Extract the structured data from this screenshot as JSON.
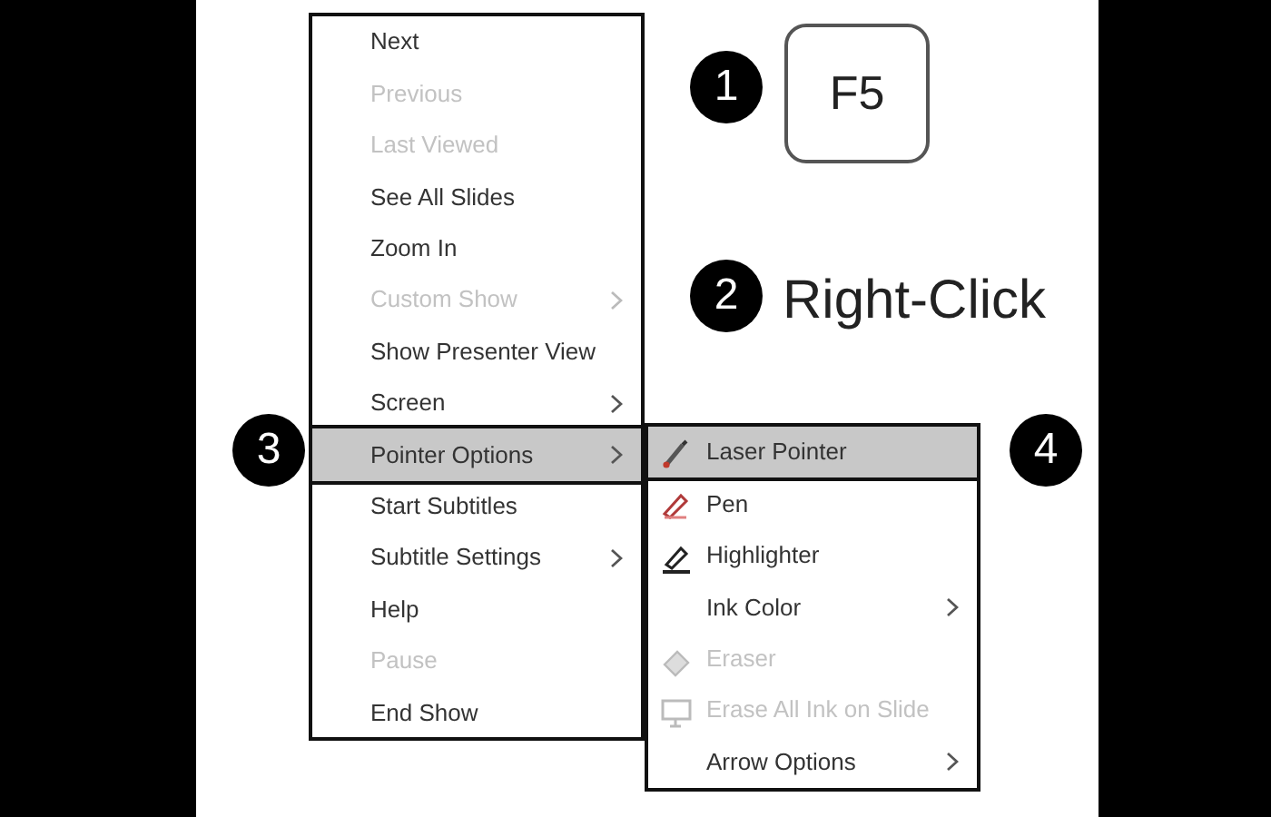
{
  "menu": {
    "items": [
      {
        "label": "Next",
        "disabled": false,
        "has_submenu": false,
        "selected": false
      },
      {
        "label": "Previous",
        "disabled": true,
        "has_submenu": false,
        "selected": false
      },
      {
        "label": "Last Viewed",
        "disabled": true,
        "has_submenu": false,
        "selected": false
      },
      {
        "label": "See All Slides",
        "disabled": false,
        "has_submenu": false,
        "selected": false
      },
      {
        "label": "Zoom In",
        "disabled": false,
        "has_submenu": false,
        "selected": false
      },
      {
        "label": "Custom Show",
        "disabled": true,
        "has_submenu": true,
        "selected": false
      },
      {
        "label": "Show Presenter View",
        "disabled": false,
        "has_submenu": false,
        "selected": false
      },
      {
        "label": "Screen",
        "disabled": false,
        "has_submenu": true,
        "selected": false
      },
      {
        "label": "Pointer Options",
        "disabled": false,
        "has_submenu": true,
        "selected": true
      },
      {
        "label": "Start Subtitles",
        "disabled": false,
        "has_submenu": false,
        "selected": false
      },
      {
        "label": "Subtitle Settings",
        "disabled": false,
        "has_submenu": true,
        "selected": false
      },
      {
        "label": "Help",
        "disabled": false,
        "has_submenu": false,
        "selected": false
      },
      {
        "label": "Pause",
        "disabled": true,
        "has_submenu": false,
        "selected": false
      },
      {
        "label": "End Show",
        "disabled": false,
        "has_submenu": false,
        "selected": false
      }
    ]
  },
  "submenu": {
    "items": [
      {
        "label": "Laser Pointer",
        "kind": "laser",
        "disabled": false,
        "has_submenu": false,
        "selected": true
      },
      {
        "label": "Pen",
        "kind": "pen",
        "disabled": false,
        "has_submenu": false,
        "selected": false
      },
      {
        "label": "Highlighter",
        "kind": "highlighter",
        "disabled": false,
        "has_submenu": false,
        "selected": false
      },
      {
        "label": "Ink Color",
        "kind": "plain",
        "disabled": false,
        "has_submenu": true,
        "selected": false
      },
      {
        "label": "Eraser",
        "kind": "eraser",
        "disabled": true,
        "has_submenu": false,
        "selected": false
      },
      {
        "label": "Erase All Ink on Slide",
        "kind": "erase-all",
        "disabled": true,
        "has_submenu": false,
        "selected": false
      },
      {
        "label": "Arrow Options",
        "kind": "plain",
        "disabled": false,
        "has_submenu": true,
        "selected": false
      }
    ]
  },
  "steps": [
    {
      "number": "1"
    },
    {
      "number": "2"
    },
    {
      "number": "3"
    },
    {
      "number": "4"
    }
  ],
  "key": "F5",
  "action": "Right-Click"
}
